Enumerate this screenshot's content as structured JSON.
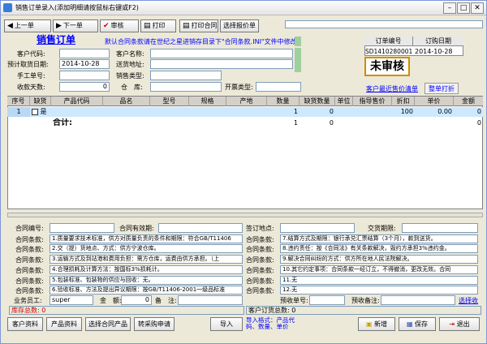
{
  "window": {
    "title": "销售订单录入(添加明细请按鼠标右键或F2)"
  },
  "toolbar": {
    "prev": "上一单",
    "next": "下一单",
    "audit": "审核",
    "print": "打印",
    "print_contract": "打印合同",
    "select_quote": "选择报价单"
  },
  "header": {
    "title": "销售订单",
    "notice": "默认合同条款请在世纪之星进销存目录下\"合同条款.INI\"文件中修改",
    "customer_code_label": "客户代码:",
    "customer_name_label": "客户名称:",
    "delivery_date_label": "预计取货日期:",
    "delivery_date": "2014-10-28",
    "ship_addr_label": "送货地址:",
    "manual_no_label": "手工单号:",
    "sales_type_label": "销售类型:",
    "deposit_label": "收款天数:",
    "deposit_value": "0",
    "warehouse_label": "仓　库:",
    "invoice_type_label": "开票类型:",
    "order_no_label": "订单编号",
    "order_no": "SD1410280001",
    "order_date_label": "订购日期",
    "order_date": "2014-10-28",
    "status": "未审核",
    "recent_price_link": "客户最近售价清单",
    "discount_btn": "整单打折"
  },
  "grid": {
    "columns": [
      "序号",
      "缺货",
      "产品代码",
      "品名",
      "型号",
      "规格",
      "产地",
      "数量",
      "缺货数量",
      "单位",
      "指导售价",
      "折扣",
      "单价",
      "金额"
    ],
    "rows": [
      {
        "no": "1",
        "check": "是",
        "qty": "1",
        "short": "0",
        "discount": "100",
        "price": "0.00",
        "amount": "0"
      }
    ],
    "total_label": "合计:",
    "total_qty": "1",
    "total_short": "0",
    "total_amount": "0"
  },
  "contract": {
    "contract_no_label": "合同编号:",
    "valid_label": "合同有效期:",
    "sign_place_label": "签订地点:",
    "deliver_period_label": "交货期限:",
    "clause_label": "合同条款:",
    "left_clauses": [
      "1.质量要求技术标准，供方对质量负责的条件和期限：符合GB/T11406",
      "2.交（提）货地点、方式：供方宁波仓库。",
      "3.运输方式及到站港和费用负担：需方仓库，运费由供方承担。（上",
      "4.合理损耗及计算方法：按国标3%损耗计。",
      "5.包装标准、包装物的供应与回收：无。",
      "6.验收标准、方法及提出异议期限：按GB/T11406-2001一级品标准"
    ],
    "right_clauses": [
      "7.结算方式及期限：银行承兑汇票结算（3个月），款到送货。",
      "8.违约责任：按《合同法》有关条款解决，毁约方承担3%违约金。",
      "9.解决合同纠纷的方式：供方所在地人民法院解决。",
      "10.其它约定事项：合同条款一经订立，不得撤消，更改无效。合同",
      "11.无",
      "12.无"
    ],
    "clerk_label": "业务员工:",
    "clerk": "super",
    "amount_label": "金　额:",
    "amount": "0",
    "remark_label": "备　注:",
    "prepay_no_label": "预收单号:",
    "prepay_remark_label": "预收备注:",
    "select_link": "选择收"
  },
  "status": {
    "stock": "库存总数: 0",
    "customer_stock": "客户订货总数: 0"
  },
  "bottom": {
    "customer": "客户资料",
    "product": "产品资料",
    "select_contract": "选择合同产品",
    "to_purchase": "转采购申请",
    "import": "导入",
    "import_hint": "导入格式：产品代码、数量、单价",
    "new": "新增",
    "save": "保存",
    "exit": "退出"
  },
  "icons": {
    "prev": "arrow-left-icon",
    "next": "arrow-right-icon",
    "audit": "check-icon",
    "print": "printer-icon"
  }
}
